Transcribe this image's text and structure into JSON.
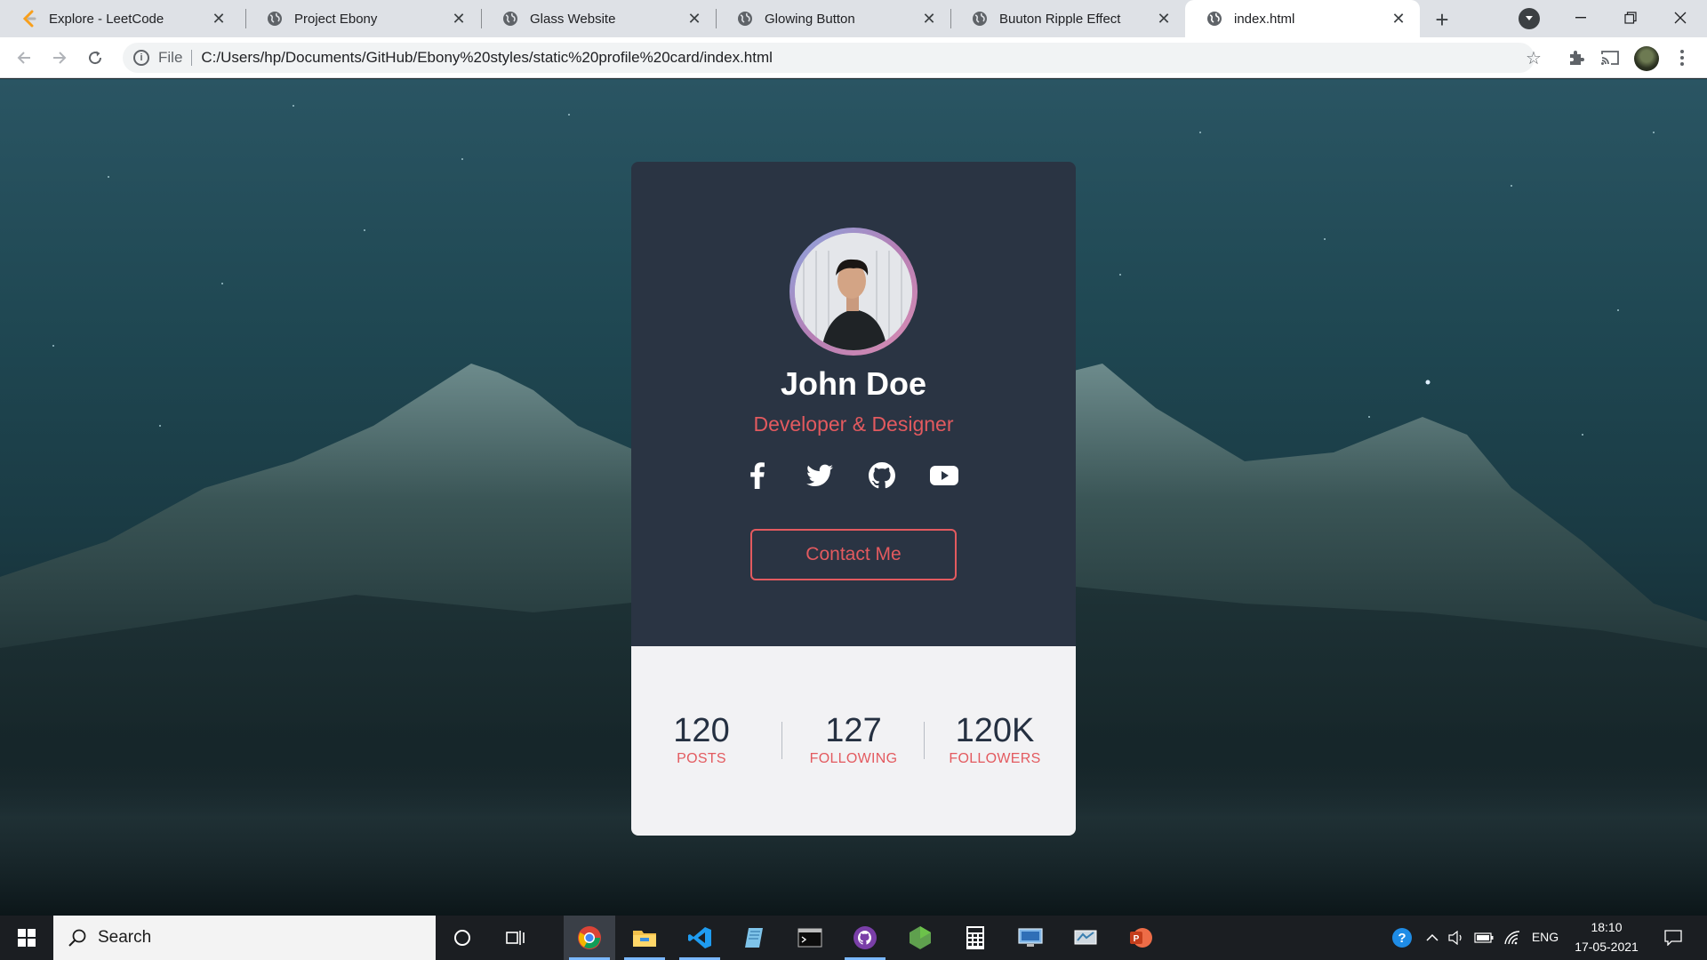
{
  "browser": {
    "tabs": [
      {
        "title": "Explore - LeetCode",
        "icon": "leetcode-icon"
      },
      {
        "title": "Project Ebony",
        "icon": "globe-icon"
      },
      {
        "title": "Glass Website",
        "icon": "globe-icon"
      },
      {
        "title": "Glowing Button",
        "icon": "globe-icon"
      },
      {
        "title": "Buuton Ripple Effect",
        "icon": "globe-icon"
      },
      {
        "title": "index.html",
        "icon": "globe-icon",
        "active": true
      }
    ],
    "address": {
      "scheme_label": "File",
      "url": "C:/Users/hp/Documents/GitHub/Ebony%20styles/static%20profile%20card/index.html"
    }
  },
  "profile": {
    "name": "John Doe",
    "role": "Developer & Designer",
    "socials": [
      "facebook-icon",
      "twitter-icon",
      "github-icon",
      "youtube-icon"
    ],
    "contact_label": "Contact Me",
    "stats": [
      {
        "value": "120",
        "label": "POSTS"
      },
      {
        "value": "127",
        "label": "FOLLOWING"
      },
      {
        "value": "120K",
        "label": "FOLLOWERS"
      }
    ]
  },
  "colors": {
    "card_top": "#2a3443",
    "card_bottom": "#f2f2f4",
    "accent": "#e35a5f"
  },
  "taskbar": {
    "search_placeholder": "Search",
    "language": "ENG",
    "time": "18:10",
    "date": "17-05-2021",
    "apps": [
      "chrome-icon",
      "file-explorer-icon",
      "vscode-icon",
      "notepad-icon",
      "terminal-icon",
      "github-desktop-icon",
      "nodejs-icon",
      "calculator-icon",
      "remote-desktop-icon",
      "control-panel-icon",
      "powerpoint-icon"
    ]
  }
}
